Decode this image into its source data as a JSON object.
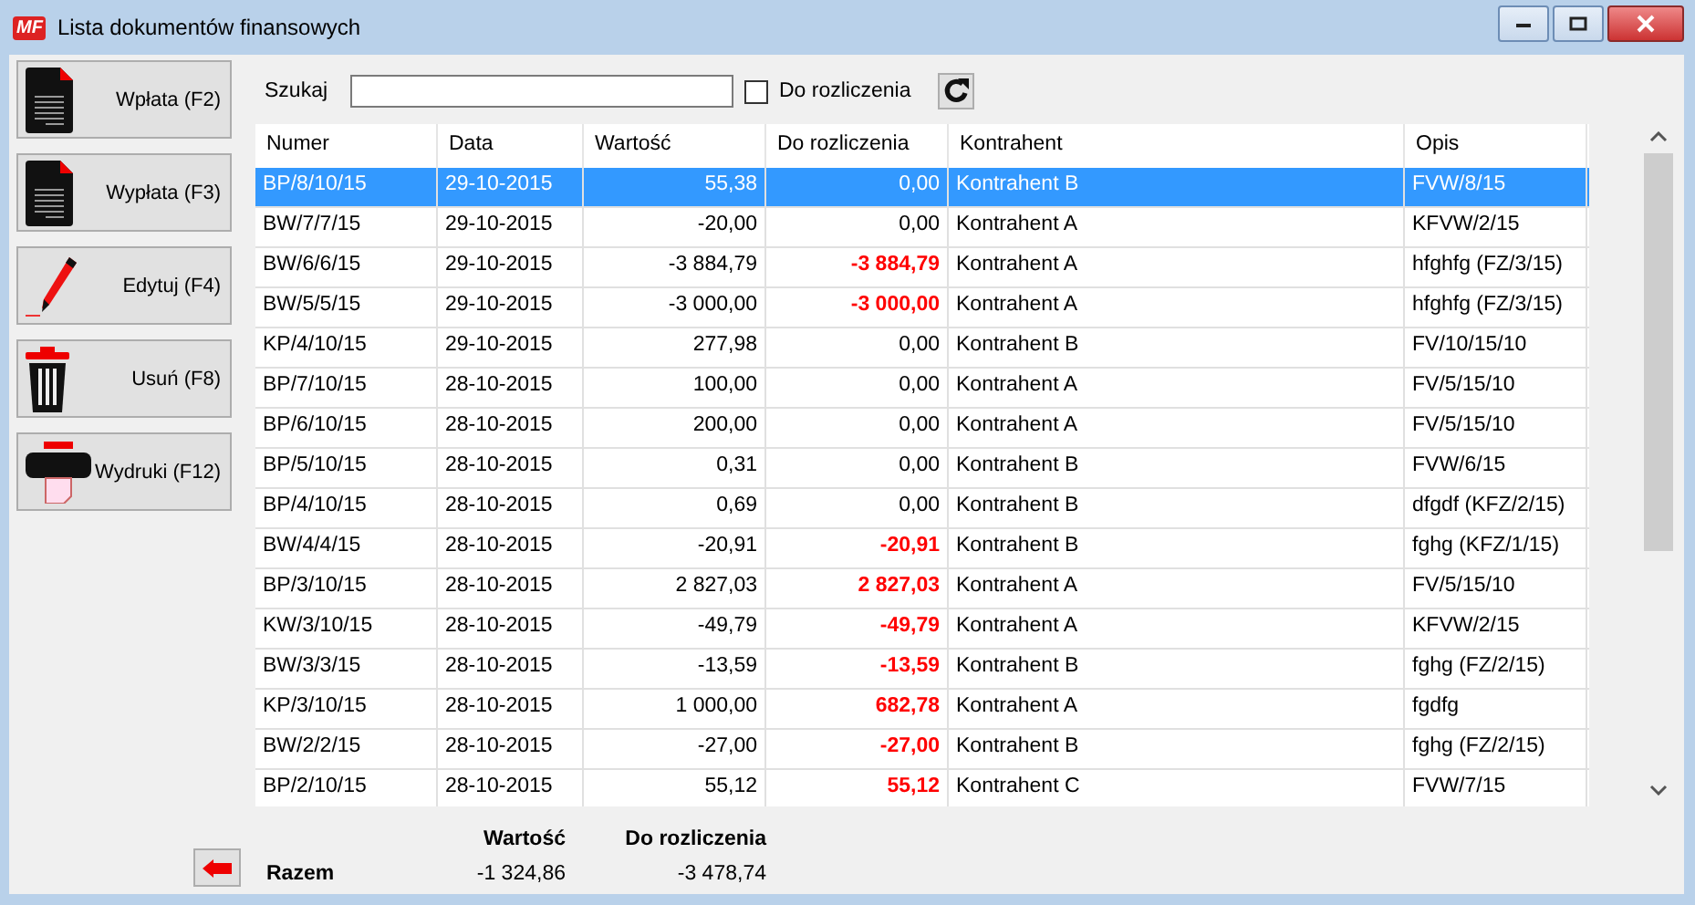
{
  "window": {
    "title": "Lista dokumentów finansowych",
    "logo": "MF"
  },
  "actions": [
    {
      "label": "Wpłata (F2)",
      "kind": "doc"
    },
    {
      "label": "Wypłata (F3)",
      "kind": "doc"
    },
    {
      "label": "Edytuj (F4)",
      "kind": "pen"
    },
    {
      "label": "Usuń (F8)",
      "kind": "trash"
    },
    {
      "label": "Wydruki (F12)",
      "kind": "printer"
    }
  ],
  "search": {
    "label": "Szukaj"
  },
  "filter": {
    "label": "Do rozliczenia",
    "checked": false
  },
  "table": {
    "columns": [
      "Numer",
      "Data",
      "Wartość",
      "Do rozliczenia",
      "Kontrahent",
      "Opis"
    ],
    "rows": [
      {
        "cells": [
          "BP/8/10/15",
          "29-10-2015",
          "55,38",
          "0,00",
          "Kontrahent B",
          "FVW/8/15"
        ],
        "selected": true,
        "outstanding": false
      },
      {
        "cells": [
          "BW/7/7/15",
          "29-10-2015",
          "-20,00",
          "0,00",
          "Kontrahent A",
          "KFVW/2/15"
        ],
        "selected": false,
        "outstanding": false
      },
      {
        "cells": [
          "BW/6/6/15",
          "29-10-2015",
          "-3 884,79",
          "-3 884,79",
          "Kontrahent A",
          "hfghfg (FZ/3/15)"
        ],
        "selected": false,
        "outstanding": true
      },
      {
        "cells": [
          "BW/5/5/15",
          "29-10-2015",
          "-3 000,00",
          "-3 000,00",
          "Kontrahent A",
          "hfghfg (FZ/3/15)"
        ],
        "selected": false,
        "outstanding": true
      },
      {
        "cells": [
          "KP/4/10/15",
          "29-10-2015",
          "277,98",
          "0,00",
          "Kontrahent B",
          "FV/10/15/10"
        ],
        "selected": false,
        "outstanding": false
      },
      {
        "cells": [
          "BP/7/10/15",
          "28-10-2015",
          "100,00",
          "0,00",
          "Kontrahent A",
          "FV/5/15/10"
        ],
        "selected": false,
        "outstanding": false
      },
      {
        "cells": [
          "BP/6/10/15",
          "28-10-2015",
          "200,00",
          "0,00",
          "Kontrahent A",
          "FV/5/15/10"
        ],
        "selected": false,
        "outstanding": false
      },
      {
        "cells": [
          "BP/5/10/15",
          "28-10-2015",
          "0,31",
          "0,00",
          "Kontrahent B",
          "FVW/6/15"
        ],
        "selected": false,
        "outstanding": false
      },
      {
        "cells": [
          "BP/4/10/15",
          "28-10-2015",
          "0,69",
          "0,00",
          "Kontrahent B",
          "dfgdf (KFZ/2/15)"
        ],
        "selected": false,
        "outstanding": false
      },
      {
        "cells": [
          "BW/4/4/15",
          "28-10-2015",
          "-20,91",
          "-20,91",
          "Kontrahent B",
          "fghg (KFZ/1/15)"
        ],
        "selected": false,
        "outstanding": true
      },
      {
        "cells": [
          "BP/3/10/15",
          "28-10-2015",
          "2 827,03",
          "2 827,03",
          "Kontrahent A",
          "FV/5/15/10"
        ],
        "selected": false,
        "outstanding": true
      },
      {
        "cells": [
          "KW/3/10/15",
          "28-10-2015",
          "-49,79",
          "-49,79",
          "Kontrahent A",
          "KFVW/2/15"
        ],
        "selected": false,
        "outstanding": true
      },
      {
        "cells": [
          "BW/3/3/15",
          "28-10-2015",
          "-13,59",
          "-13,59",
          "Kontrahent B",
          "fghg (FZ/2/15)"
        ],
        "selected": false,
        "outstanding": true
      },
      {
        "cells": [
          "KP/3/10/15",
          "28-10-2015",
          "1 000,00",
          "682,78",
          "Kontrahent A",
          "fgdfg"
        ],
        "selected": false,
        "outstanding": true
      },
      {
        "cells": [
          "BW/2/2/15",
          "28-10-2015",
          "-27,00",
          "-27,00",
          "Kontrahent B",
          "fghg (FZ/2/15)"
        ],
        "selected": false,
        "outstanding": true
      },
      {
        "cells": [
          "BP/2/10/15",
          "28-10-2015",
          "55,12",
          "55,12",
          "Kontrahent C",
          "FVW/7/15"
        ],
        "selected": false,
        "outstanding": true
      }
    ]
  },
  "totals": {
    "headings": [
      "Wartość",
      "Do rozliczenia"
    ],
    "label": "Razem",
    "values": [
      "-1 324,86",
      "-3 478,74"
    ]
  }
}
